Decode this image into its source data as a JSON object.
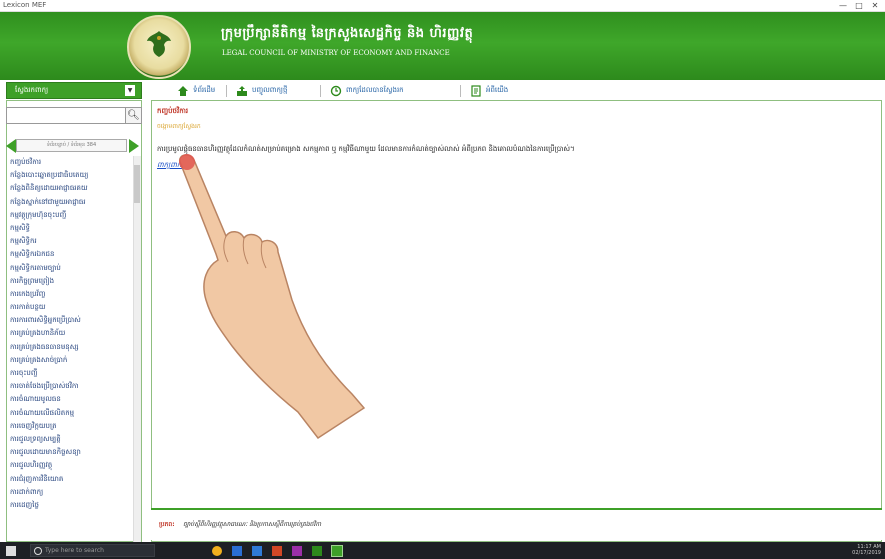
{
  "window": {
    "title": "Lexicon MEF",
    "controls": [
      "—",
      "□",
      "✕"
    ]
  },
  "banner": {
    "title_km": "ក្រុមប្រឹក្សានីតិកម្ម នៃក្រសួងសេដ្ឋកិច្ច និង ហិរញ្ញវត្ថុ",
    "title_en": "LEGAL COUNCIL OF MINISTRY OF ECONOMY AND FINANCE"
  },
  "sidebar": {
    "header_label": "ស្វែងរកពាក្យ",
    "search_placeholder": "",
    "pager_text": "ទំព័រ​បន្ទាប់ / ទំព័រ​មុន 384",
    "items": [
      "កញ្ចប់ថវិការ",
      "កន្លែងបោះឆ្នោតប្រជាធិបតេយ្យ",
      "កន្លែងពិនិត្យ​ដោយ​អាជ្ញាធរ​គយ",
      "កន្លែងស្នាក់នៅជាមួយអាជ្ញាធរ",
      "កម្មវត្ថុក្រុមហ៊ុនចុះបញ្ជី",
      "កម្មសិទ្ធិ",
      "កម្មសិទ្ធិករ",
      "កម្មសិទ្ធិករឯកជន",
      "កម្មសិទ្ធិករតាមច្បាប់",
      "ការកិច្ចព្រមព្រៀង",
      "ការកេងប្រវ័ញ្ច",
      "ការកាត់បន្ថយ",
      "ការការពារសិទ្ធិអ្នកប្រើប្រាស់",
      "ការគ្រប់គ្រងហានិភ័យ",
      "ការគ្រប់គ្រងធនធានមនុស្ស",
      "ការគ្រប់គ្រងសាច់ប្រាក់",
      "ការចុះបញ្ជី",
      "ការចាត់ចែងប្រើប្រាស់ថវិកា",
      "ការចំណាយមូលធន",
      "ការចំណាយលើផលិតកម្ម",
      "ការចេញវិក្កយបត្រ",
      "ការជួលទ្រព្យសម្បត្តិ",
      "ការជួលដោយមានកិច្ចសន្យា",
      "ការជួលហិរញ្ញវត្ថុ",
      "ការជំរុញការវិនិយោគ",
      "ការដាក់ពាក្យ",
      "ការដេញថ្លៃ"
    ]
  },
  "toolbar": {
    "home": "ទំព័រដើម",
    "export": "បញ្ចូលពាក្យថ្មី",
    "history": "ពាក្យដែលបានស្វែងរក",
    "info": "អំពីយើង"
  },
  "main": {
    "term": "កញ្ចប់ថវិការ",
    "subtitle": "ចង្កោមពាក្យស្វែងរក",
    "definition": "ការប្រមូលផ្តុំធនធានហិរញ្ញវត្ថុដែលកំណត់សម្រាប់គម្រោង សកម្មភាព ឬ កម្មវិធីណាមួយ ដែលមានការកំណត់ច្បាស់លាស់ អំពីប្រភព និងគោលបំណងនៃការប្រើប្រាស់។",
    "link": "ពាក្យពាក់ព័ន្ធ"
  },
  "footer": {
    "label": "ប្រភព:",
    "value": "ច្បាប់ស្តីពីហិរញ្ញវត្ថុសាធារណៈ និងប្រកាសស្តីពីការគ្រប់គ្រងថវិកា"
  },
  "taskbar": {
    "search_placeholder": "Type here to search",
    "time": "11:17 AM",
    "date": "02/17/2019"
  },
  "colors": {
    "banner_green": "#3fa72a",
    "accent_green": "#3ea028",
    "term_red": "#c0392b",
    "subtitle_gold": "#d9a22a",
    "link_blue": "#1a4fc7"
  }
}
